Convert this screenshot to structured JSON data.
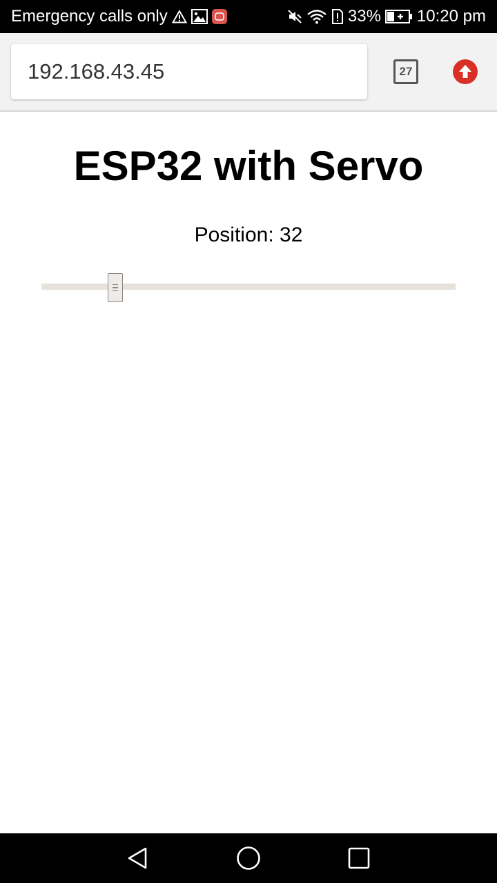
{
  "status_bar": {
    "carrier_text": "Emergency calls only",
    "battery_percent": "33%",
    "time": "10:20 pm",
    "icons": [
      "warning-icon",
      "image-alert-icon",
      "app-notification-icon",
      "mute-icon",
      "wifi-icon",
      "sim-alert-icon",
      "battery-charging-icon"
    ]
  },
  "browser": {
    "url": "192.168.43.45",
    "tab_count": "27",
    "update_icon": "arrow-up-circle-icon",
    "accent_color": "#d93025"
  },
  "page": {
    "title": "ESP32 with Servo",
    "position_label": "Position: ",
    "position_value": "32",
    "slider": {
      "min": 0,
      "max": 180,
      "value": 32
    }
  },
  "nav_bar": {
    "icons": [
      "back-icon",
      "home-icon",
      "recents-icon"
    ]
  }
}
